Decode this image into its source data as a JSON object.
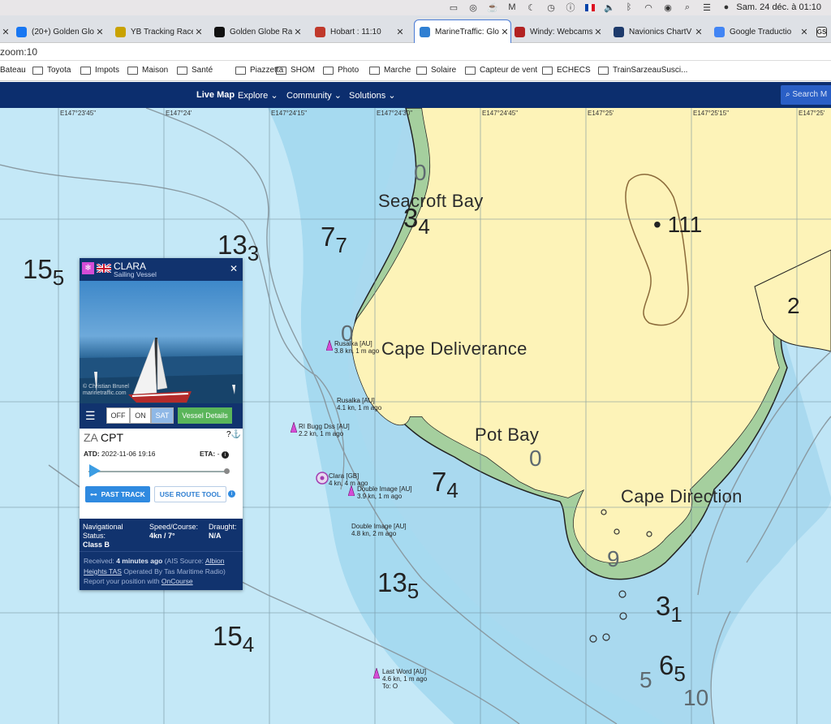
{
  "mac": {
    "clock": "Sam. 24 déc. à 01:10"
  },
  "tabs": [
    {
      "title": "(20+) Golden Glo",
      "fav": "f",
      "color": "#1877f2"
    },
    {
      "title": "YB Tracking Race",
      "fav": "yb",
      "color": "#c9a200"
    },
    {
      "title": "Golden Globe Rac",
      "fav": "gg",
      "color": "#111111"
    },
    {
      "title": "Hobart : 11:10",
      "fav": "L",
      "color": "#c0392b"
    },
    {
      "title": "MarineTraffic: Glo",
      "fav": "mt",
      "color": "#2f7fd2"
    },
    {
      "title": "Windy: Webcams",
      "fav": "w",
      "color": "#b22222"
    },
    {
      "title": "Navionics ChartV",
      "fav": "n",
      "color": "#1d3a6b"
    },
    {
      "title": "Google Traductio",
      "fav": "G",
      "color": "#4285f4"
    }
  ],
  "address": "zoom:10",
  "bookmarks": [
    "Bateau",
    "Toyota",
    "Impots",
    "Maison",
    "Santé",
    "Piazzetta",
    "SHOM",
    "Photo",
    "Marche",
    "Solaire",
    "Capteur de vent",
    "ECHECS",
    "TrainSarzeauSusci..."
  ],
  "nav": {
    "items": [
      "Live Map",
      "Explore",
      "Community",
      "Solutions"
    ],
    "search": "Search M"
  },
  "map": {
    "coords": [
      "E147°23'45\"",
      "E147°24'",
      "E147°24'15\"",
      "E147°24'30\"",
      "E147°24'45\"",
      "E147°25'",
      "E147°25'15\"",
      "E147°25'"
    ],
    "places": [
      "Seacroft Bay",
      "Cape Deliverance",
      "Pot Bay",
      "Cape Direction"
    ],
    "depths": [
      {
        "main": "15",
        "sub": "5"
      },
      {
        "main": "13",
        "sub": "3"
      },
      {
        "main": "7",
        "sub": "7"
      },
      {
        "main": "3",
        "sub": "4"
      },
      {
        "main": "7",
        "sub": "4"
      },
      {
        "main": "13",
        "sub": "5"
      },
      {
        "main": "15",
        "sub": "4"
      },
      {
        "main": "3",
        "sub": "1"
      },
      {
        "main": "6",
        "sub": "5"
      },
      {
        "main": "• 111",
        "sub": ""
      },
      {
        "main": "2",
        "sub": ""
      },
      {
        "main": "0",
        "sub": ""
      },
      {
        "main": "0",
        "sub": ""
      },
      {
        "main": "0",
        "sub": ""
      },
      {
        "main": "10",
        "sub": ""
      },
      {
        "main": "5",
        "sub": ""
      },
      {
        "main": "9",
        "sub": ""
      }
    ],
    "vessels": [
      {
        "name": "Rusalka [AU]",
        "info": "3.8 kn, 1 m ago"
      },
      {
        "name": "Rusalka [AU]",
        "info": "4.1 kn, 1 m ago"
      },
      {
        "name": "RI Bugg Dss [AU]",
        "info": "2.2 kn, 1 m ago"
      },
      {
        "name": "Clara [GB]",
        "info": "4 kn, 4 m ago"
      },
      {
        "name": "Double Image [AU]",
        "info": "3.9 kn, 1 m ago"
      },
      {
        "name": "Double Image [AU]",
        "info": "4.8 kn, 2 m ago"
      },
      {
        "name": "Last Word [AU]",
        "info": "4.6 kn, 1 m ago",
        "extra": "To: O"
      }
    ]
  },
  "panel": {
    "name": "CLARA",
    "type": "Sailing Vessel",
    "watermark": "© Christian Brunel marinetraffic.com",
    "toggle": [
      "OFF",
      "ON",
      "SAT"
    ],
    "details_button": "Vessel Details",
    "dest_prefix": "ZA",
    "dest": "CPT",
    "atd_label": "ATD:",
    "atd": "2022-11-06 19:16",
    "eta_label": "ETA:",
    "eta": "-",
    "progress_fraction": 0.02,
    "past_track": "PAST TRACK",
    "route_tool": "USE ROUTE TOOL",
    "nav_status_label": "Navigational Status:",
    "nav_status": "Class B",
    "speed_label": "Speed/Course:",
    "speed": "4kn / 7°",
    "draught_label": "Draught:",
    "draught": "N/A",
    "received_label": "Received:",
    "received": "4 minutes ago",
    "ais_pre": "(AIS Source:",
    "ais_link": "Albion Heights TAS",
    "ais_post": "Operated By Tas Maritime Radio)",
    "report_pre": "Report your position with",
    "report_link": "OnCourse"
  },
  "colors": {
    "land": "#fdf4b9",
    "shallow": "#aee0f3",
    "deep": "#c7e9f7",
    "intertidal": "#a9d2a4",
    "navbar": "#0c2e6e",
    "vessel": "#d54cd6"
  }
}
